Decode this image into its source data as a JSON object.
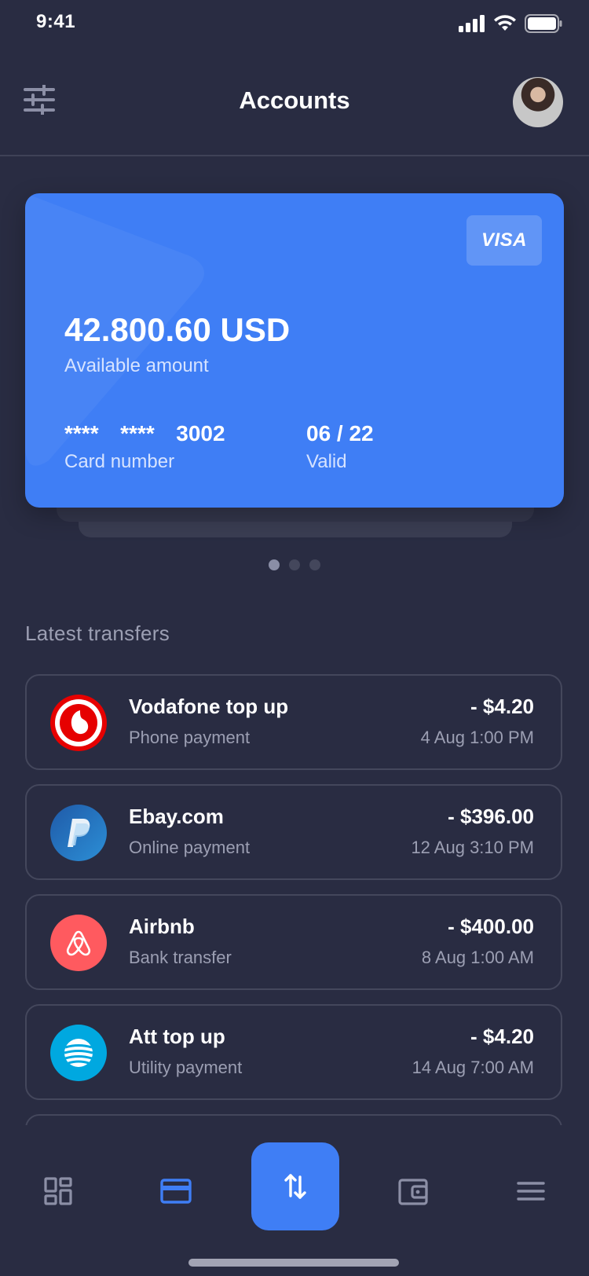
{
  "status_bar": {
    "time": "9:41"
  },
  "header": {
    "title": "Accounts"
  },
  "card": {
    "brand": "VISA",
    "amount": "42.800.60 USD",
    "amount_label": "Available amount",
    "number": "****  ****  3002",
    "number_label": "Card number",
    "valid": "06 / 22",
    "valid_label": "Valid",
    "color": "#3f7ef5"
  },
  "carousel": {
    "pages": 3,
    "active": 1
  },
  "transfers": {
    "title": "Latest transfers",
    "items": [
      {
        "title": "Vodafone top up",
        "subtitle": "Phone payment",
        "amount": "- $4.20",
        "time": "4 Aug 1:00 PM",
        "icon": "vodafone-logo"
      },
      {
        "title": "Ebay.com",
        "subtitle": "Online payment",
        "amount": "- $396.00",
        "time": "12 Aug 3:10 PM",
        "icon": "paypal-logo"
      },
      {
        "title": "Airbnb",
        "subtitle": "Bank transfer",
        "amount": "- $400.00",
        "time": "8 Aug 1:00 AM",
        "icon": "airbnb-logo"
      },
      {
        "title": "Att top up",
        "subtitle": "Utility payment",
        "amount": "- $4.20",
        "time": "14 Aug 7:00 AM",
        "icon": "att-logo"
      }
    ]
  },
  "nav": {
    "items": [
      "dashboard-icon",
      "card-icon",
      "transfer-icon",
      "wallet-icon",
      "menu-icon"
    ],
    "active": "card-icon",
    "accent": "#3f7ef5"
  }
}
